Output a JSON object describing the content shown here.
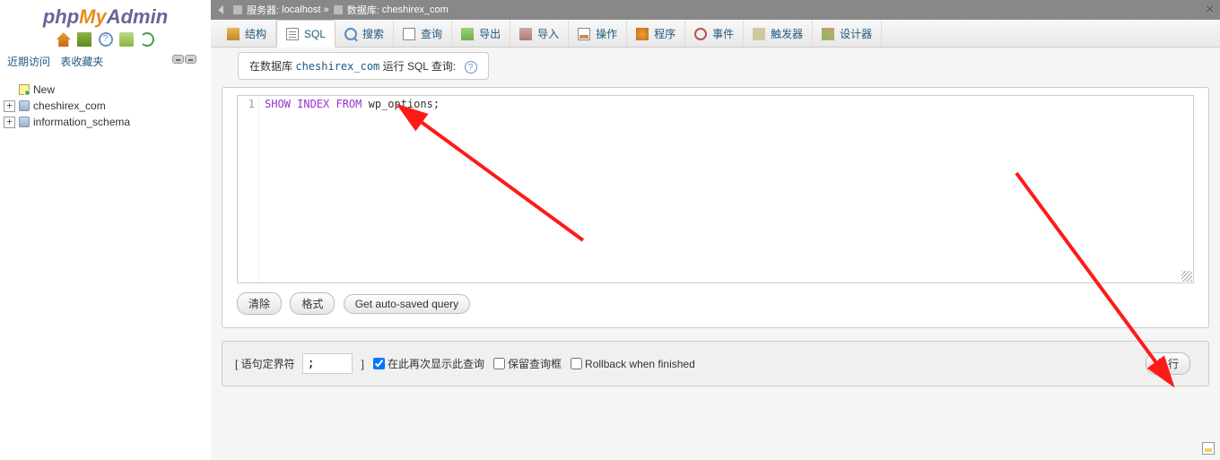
{
  "logo": {
    "part1": "php",
    "part2": "My",
    "part3": "Admin"
  },
  "sidebar": {
    "recent": "近期访问",
    "favorites": "表收藏夹",
    "tree": {
      "new": "New",
      "db1": "cheshirex_com",
      "db2": "information_schema"
    }
  },
  "breadcrumb": {
    "server_label": "服务器:",
    "server_value": "localhost",
    "sep": "»",
    "db_label": "数据库:",
    "db_value": "cheshirex_com"
  },
  "tabs": {
    "structure": "结构",
    "sql": "SQL",
    "search": "搜索",
    "query": "查询",
    "export": "导出",
    "import": "导入",
    "operations": "操作",
    "routines": "程序",
    "events": "事件",
    "triggers": "触发器",
    "designer": "设计器"
  },
  "sql": {
    "header_prefix": "在数据库",
    "header_db": "cheshirex_com",
    "header_suffix": "运行 SQL 查询:",
    "line_num": "1",
    "kw": "SHOW INDEX FROM",
    "tbl": " wp_options;",
    "clear_btn": "清除",
    "format_btn": "格式",
    "autosaved_btn": "Get auto-saved query"
  },
  "footer": {
    "delimiter_label": "[ 语句定界符",
    "delimiter_value": ";",
    "bracket_close": "]",
    "show_again": "在此再次显示此查询",
    "retain": "保留查询框",
    "rollback": "Rollback when finished",
    "go_btn": "执行"
  }
}
